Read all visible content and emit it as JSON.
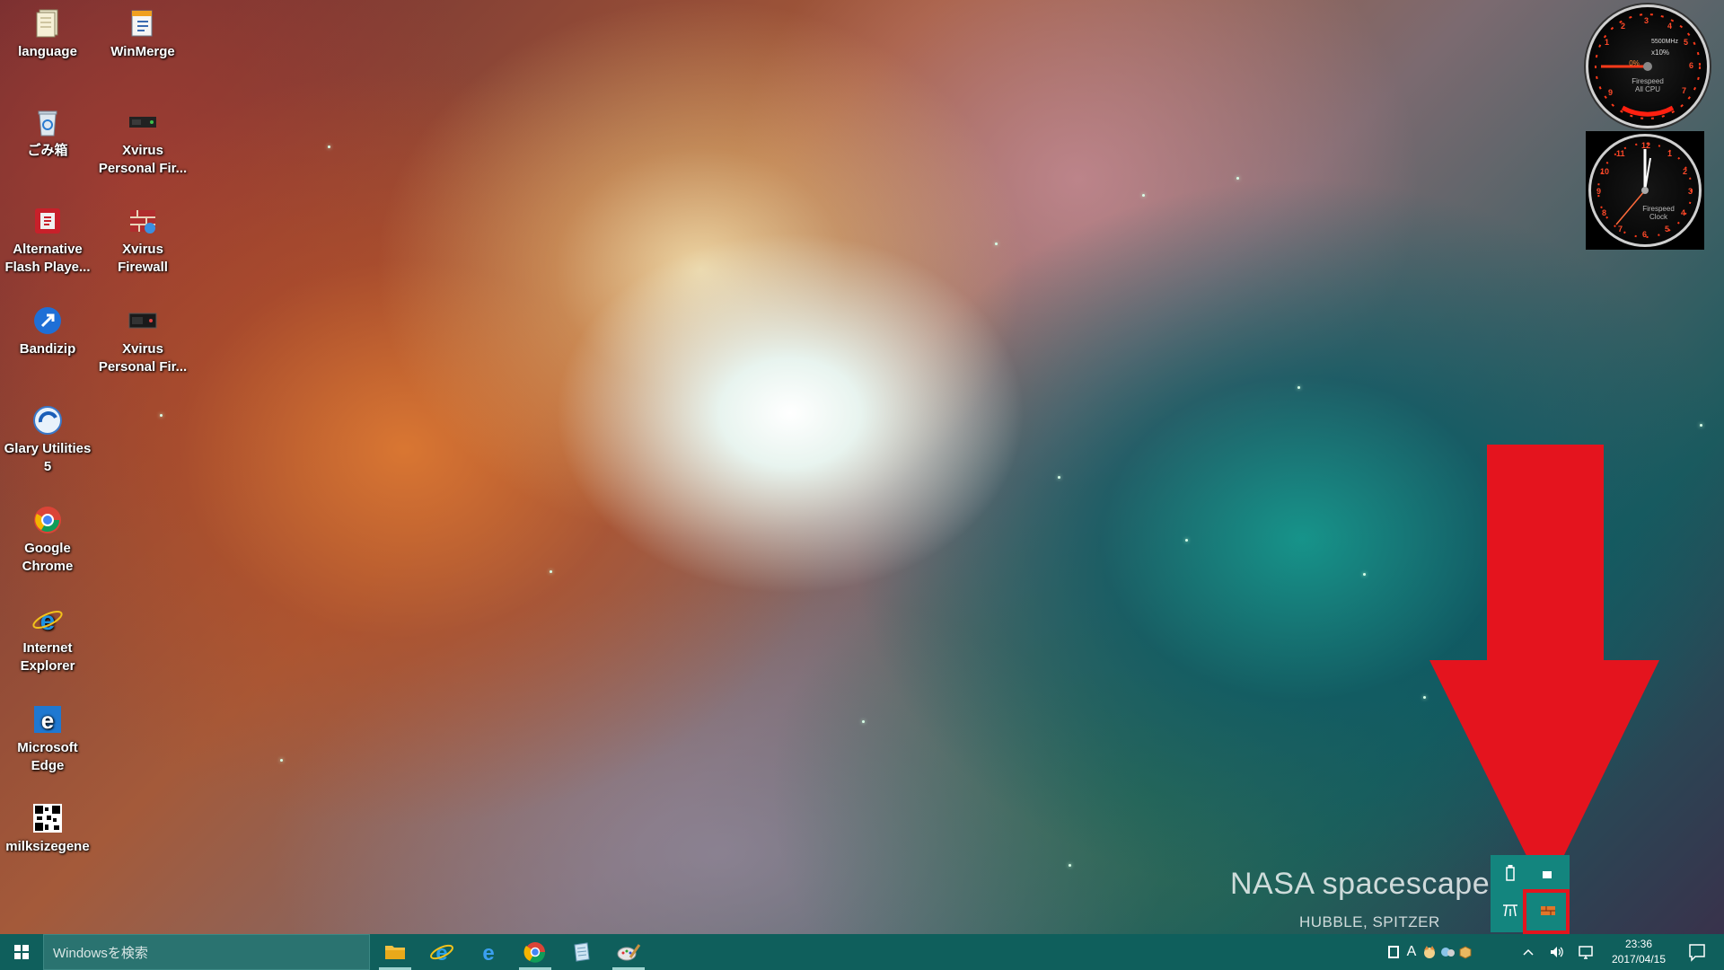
{
  "desktop": {
    "icons": [
      {
        "label": "language",
        "icon": "folder-document-icon"
      },
      {
        "label": "WinMerge",
        "icon": "winmerge-icon"
      },
      {
        "label": "ごみ箱",
        "icon": "recycle-bin-icon"
      },
      {
        "label": "Xvirus Personal Fir...",
        "icon": "xvirus-personal-firewall-icon"
      },
      {
        "label": "Alternative Flash Playe...",
        "icon": "flash-player-icon"
      },
      {
        "label": "Xvirus Firewall",
        "icon": "xvirus-firewall-icon"
      },
      {
        "label": "Bandizip",
        "icon": "bandizip-icon"
      },
      {
        "label": "Xvirus Personal Fir...",
        "icon": "xvirus-personal-firewall-icon"
      },
      {
        "label": "Glary Utilities 5",
        "icon": "glary-utilities-icon"
      },
      {
        "label": "Google Chrome",
        "icon": "chrome-icon"
      },
      {
        "label": "Internet Explorer",
        "icon": "internet-explorer-icon"
      },
      {
        "label": "Microsoft Edge",
        "icon": "edge-icon"
      },
      {
        "label": "milksizegene",
        "icon": "qr-code-icon"
      }
    ]
  },
  "gadgets": {
    "cpu": {
      "speed": "5500MHz",
      "multiplier": "x10%",
      "percent": "0%",
      "caption_line1": "Firespeed",
      "caption_line2": "All CPU"
    },
    "clock": {
      "caption_line1": "Firespeed",
      "caption_line2": "Clock"
    }
  },
  "wallpaper": {
    "title": "NASA spacescapes",
    "subtitle": "HUBBLE, SPITZER"
  },
  "taskbar": {
    "search_placeholder": "Windowsを検索",
    "pinned_apps": [
      {
        "name": "File Explorer",
        "icon": "file-explorer-icon",
        "active": true
      },
      {
        "name": "Internet Explorer",
        "icon": "internet-explorer-icon",
        "active": false
      },
      {
        "name": "Microsoft Edge",
        "icon": "edge-icon",
        "active": false
      },
      {
        "name": "Google Chrome",
        "icon": "chrome-icon",
        "active": true
      },
      {
        "name": "Notepad",
        "icon": "notepad-icon",
        "active": false
      },
      {
        "name": "Paint",
        "icon": "paint-icon",
        "active": true
      }
    ],
    "tray": {
      "ime_label": "A",
      "time": "23:36",
      "date": "2017/04/15"
    }
  },
  "colors": {
    "taskbar": "#0f5f5c",
    "flyout": "#13857e",
    "annotation": "#e4141e"
  }
}
